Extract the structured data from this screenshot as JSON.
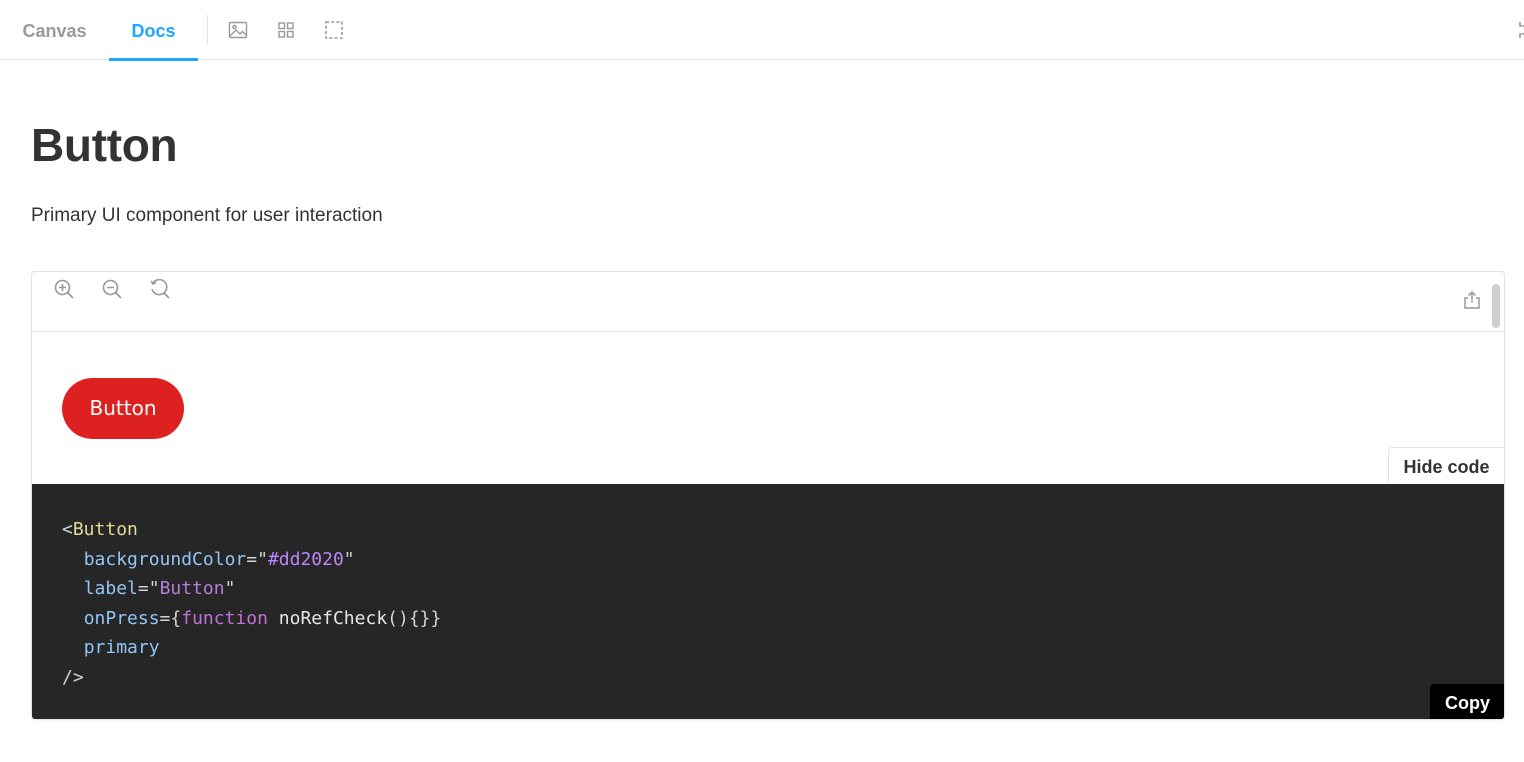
{
  "toolbar": {
    "tabs": [
      {
        "label": "Canvas",
        "active": false
      },
      {
        "label": "Docs",
        "active": true
      }
    ],
    "icons": [
      "image-icon",
      "grid-icon",
      "outline-icon",
      "fullscreen-icon"
    ]
  },
  "docs": {
    "title": "Button",
    "description": "Primary UI component for user interaction"
  },
  "preview": {
    "toolbar_icons": [
      "zoom-in-icon",
      "zoom-out-icon",
      "reset-zoom-icon",
      "share-icon"
    ],
    "story_button_label": "Button",
    "story_button_color": "#dd2020",
    "hide_code_label": "Hide code",
    "copy_label": "Copy",
    "code": {
      "open": "<",
      "tag": "Button",
      "attr1_name": "backgroundColor",
      "eq": "=",
      "quote": "\"",
      "attr1_value": "#dd2020",
      "attr2_name": "label",
      "attr2_value": "Button",
      "attr3_name": "onPress",
      "attr3_open": "={",
      "attr3_keyword": "function",
      "attr3_fn": "noRefCheck",
      "attr3_rest": "(){}}",
      "attr4_name": "primary",
      "close": "/>"
    }
  },
  "colors": {
    "accent": "#1ea7fd",
    "code_background": "#262626"
  }
}
